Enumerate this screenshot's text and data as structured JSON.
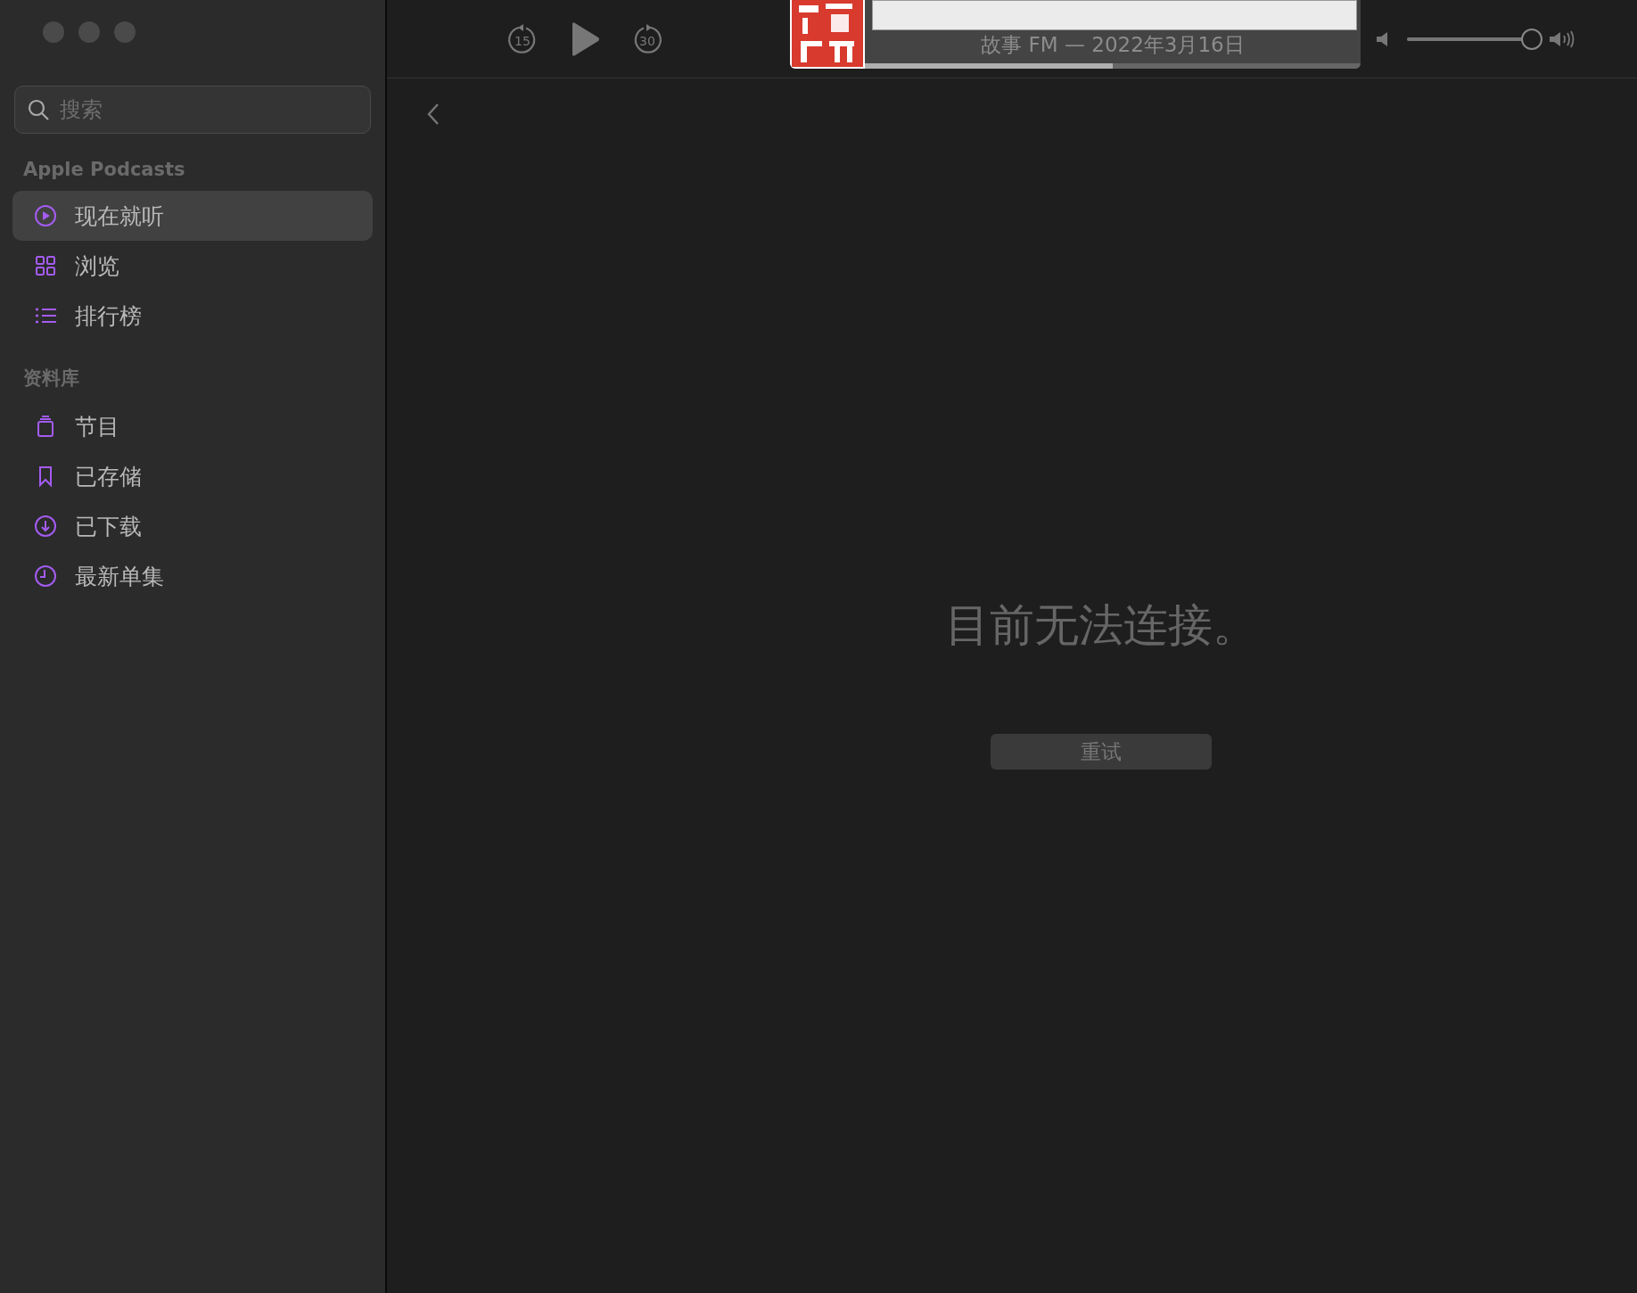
{
  "sidebar": {
    "search": {
      "placeholder": "搜索"
    },
    "sections": [
      {
        "header": "Apple Podcasts",
        "items": [
          {
            "label": "现在就听",
            "kind": "play",
            "selected": true
          },
          {
            "label": "浏览",
            "kind": "grid",
            "selected": false
          },
          {
            "label": "排行榜",
            "kind": "list",
            "selected": false
          }
        ]
      },
      {
        "header": "资料库",
        "items": [
          {
            "label": "节目",
            "kind": "stack",
            "selected": false
          },
          {
            "label": "已存储",
            "kind": "bookmark",
            "selected": false
          },
          {
            "label": "已下载",
            "kind": "download",
            "selected": false
          },
          {
            "label": "最新单集",
            "kind": "clock",
            "selected": false
          }
        ]
      }
    ]
  },
  "player": {
    "skip_back": "15",
    "skip_forward": "30",
    "title": "故事 FM — 2022年3月16日",
    "progress": {
      "level": 0.5
    },
    "volume": {
      "level": 1
    }
  },
  "main": {
    "message": "目前无法连接。",
    "retry_button": "重试"
  }
}
